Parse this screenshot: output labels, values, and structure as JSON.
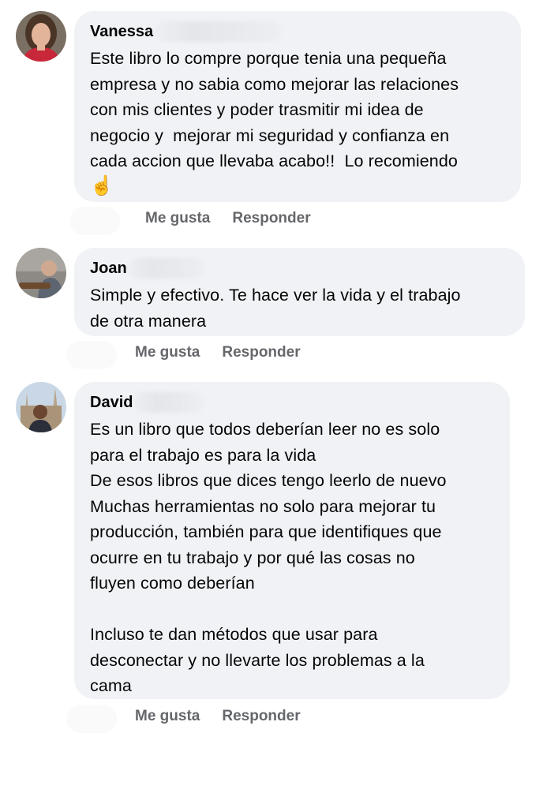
{
  "comments": [
    {
      "author": "Vanessa",
      "text": "Este libro lo compre porque tenia una pequeña\nempresa y no sabia como mejorar las relaciones\ncon mis clientes y poder trasmitir mi idea de\nnegocio y  mejorar mi seguridad y confianza en\ncada accion que llevaba acabo!!  Lo recomiendo",
      "emoji": "☝",
      "like_label": "Me gusta",
      "reply_label": "Responder"
    },
    {
      "author": "Joan",
      "text": "Simple y efectivo. Te hace ver la vida y el trabajo\nde otra manera",
      "like_label": "Me gusta",
      "reply_label": "Responder"
    },
    {
      "author": "David",
      "text": "Es un libro que todos deberían leer no es solo\npara el trabajo es para la vida\nDe esos libros que dices tengo leerlo de nuevo\nMuchas herramientas no solo para mejorar tu\nproducción, también para que identifiques que\nocurre en tu trabajo y por qué las cosas no\nfluyen como deberían\n\nIncluso te dan métodos que usar para\ndesconectar y no llevarte los problemas a la\ncama",
      "like_label": "Me gusta",
      "reply_label": "Responder"
    }
  ],
  "colors": {
    "bubble": "#f0f2f5",
    "text": "#050505",
    "secondary": "#65676b"
  }
}
